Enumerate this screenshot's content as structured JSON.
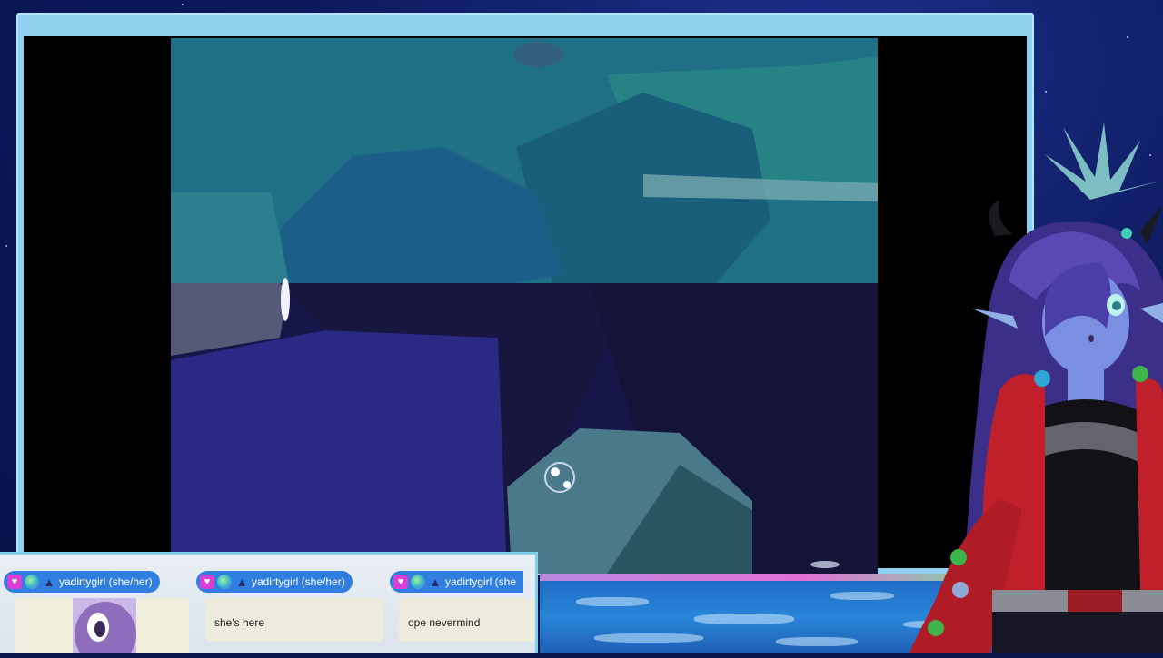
{
  "stream": {
    "chat": {
      "messages": [
        {
          "username": "yadirtygirl (she/her)",
          "text": ""
        },
        {
          "username": "yadirtygirl (she/her)",
          "text": "she's here"
        },
        {
          "username": "yadirtygirl (she",
          "text": "ope nevermind"
        }
      ]
    }
  },
  "icons": {
    "badge_1": "heart-badge-icon",
    "badge_2": "globe-badge-icon",
    "badge_3": "witch-hat-badge-icon"
  },
  "colors": {
    "frame": "#8fd0ef",
    "chat_header": "#2f7ee0",
    "badge_heart": "#d83fd6",
    "water": "#2a86d9"
  }
}
